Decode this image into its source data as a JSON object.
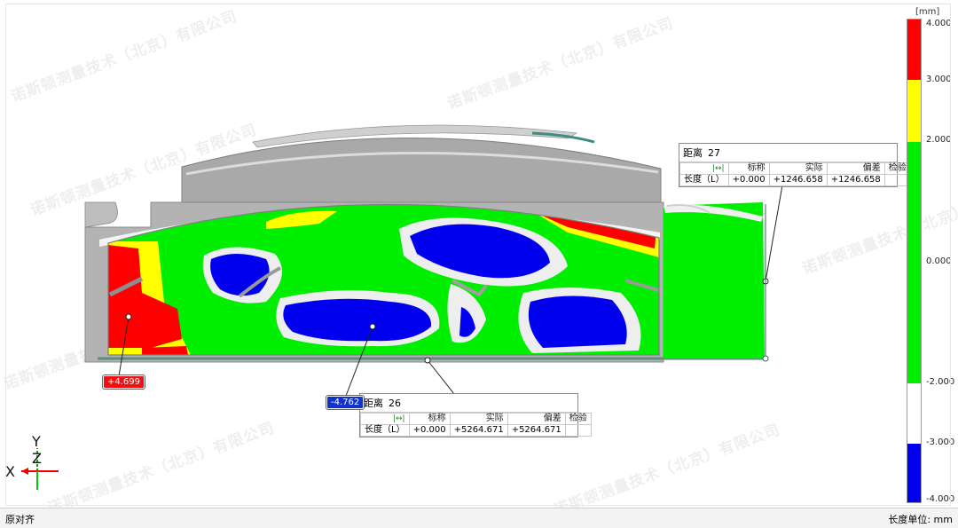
{
  "watermark_text": "诺斯顿测量技术（北京）有限公司",
  "legend": {
    "unit": "[mm]",
    "ticks": [
      "4.000",
      "3.000",
      "2.000",
      "0.000",
      "-2.000",
      "-3.000",
      "-4.000"
    ],
    "colors": {
      "red": "#ff0000",
      "yellow": "#ffff00",
      "green": "#00ee00",
      "white": "#ffffff",
      "blue": "#0000ee"
    }
  },
  "callouts": [
    {
      "title": "距离",
      "number": "27",
      "icon": "distance-icon",
      "headers": [
        "标称",
        "实际",
        "偏差",
        "检验"
      ],
      "row_label": "长度（L）",
      "nominal": "+0.000",
      "actual": "+1246.658",
      "deviation": "+1246.658",
      "check": ""
    },
    {
      "title": "距离",
      "number": "26",
      "icon": "distance-icon",
      "headers": [
        "标称",
        "实际",
        "偏差",
        "检验"
      ],
      "row_label": "长度（L）",
      "nominal": "+0.000",
      "actual": "+5264.671",
      "deviation": "+5264.671",
      "check": ""
    }
  ],
  "deviation_labels": [
    {
      "value": "+4.699",
      "color": "#ee1111"
    },
    {
      "value": "-4.762",
      "color": "#1133cc"
    }
  ],
  "axes": {
    "x": "X",
    "y": "Y",
    "z": "Z"
  },
  "status_bar": {
    "left_text": "原对齐",
    "right_text": "长度单位: mm"
  }
}
